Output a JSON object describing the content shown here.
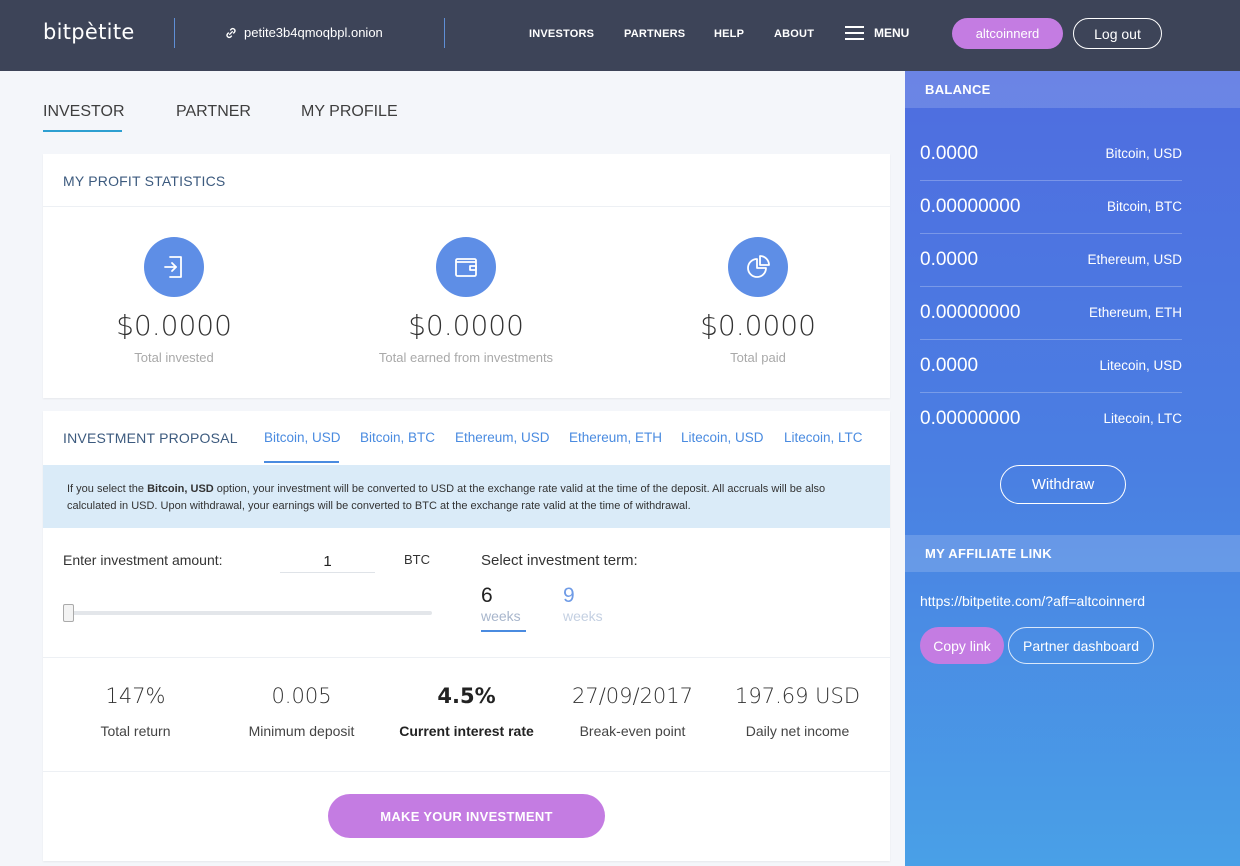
{
  "header": {
    "logo": "bitpètite",
    "onion_address": "petite3b4qmoqbpl.onion",
    "nav": [
      "INVESTORS",
      "PARTNERS",
      "HELP",
      "ABOUT"
    ],
    "menu_label": "MENU",
    "username": "altcoinnerd",
    "logout_label": "Log out"
  },
  "tabs": [
    "INVESTOR",
    "PARTNER",
    "MY PROFILE"
  ],
  "profit_stats": {
    "title": "MY PROFIT STATISTICS",
    "items": [
      {
        "value": "$0.0000",
        "label": "Total invested",
        "icon": "login-icon"
      },
      {
        "value": "$0.0000",
        "label": "Total earned from investments",
        "icon": "wallet-icon"
      },
      {
        "value": "$0.0000",
        "label": "Total paid",
        "icon": "pie-chart-icon"
      }
    ]
  },
  "proposal": {
    "title": "INVESTMENT PROPOSAL",
    "currency_tabs": [
      "Bitcoin, USD",
      "Bitcoin, BTC",
      "Ethereum, USD",
      "Ethereum, ETH",
      "Litecoin, USD",
      "Litecoin, LTC"
    ],
    "info_pre": "If you select the ",
    "info_bold": "Bitcoin, USD",
    "info_post": " option, your investment will be converted to USD at the exchange rate valid at the time of the deposit. All accruals will be also calculated in USD. Upon withdrawal, your earnings will be converted to BTC at the exchange rate valid at the time of withdrawal.",
    "amount_label": "Enter investment amount:",
    "amount_value": "1",
    "amount_unit": "BTC",
    "term_label": "Select investment term:",
    "terms": [
      {
        "num": "6",
        "unit": "weeks"
      },
      {
        "num": "9",
        "unit": "weeks"
      }
    ],
    "metrics": [
      {
        "value": "147%",
        "label": "Total return"
      },
      {
        "value": "0.005",
        "label": "Minimum deposit"
      },
      {
        "value": "4.5%",
        "label": "Current interest rate"
      },
      {
        "value": "27/09/2017",
        "label": "Break-even point"
      },
      {
        "value": "197.69 USD",
        "label": "Daily net income"
      }
    ],
    "invest_button": "MAKE YOUR INVESTMENT"
  },
  "sidebar": {
    "balance_title": "BALANCE",
    "balances": [
      {
        "amount": "0.0000",
        "label": "Bitcoin, USD"
      },
      {
        "amount": "0.00000000",
        "label": "Bitcoin, BTC"
      },
      {
        "amount": "0.0000",
        "label": "Ethereum, USD"
      },
      {
        "amount": "0.00000000",
        "label": "Ethereum, ETH"
      },
      {
        "amount": "0.0000",
        "label": "Litecoin, USD"
      },
      {
        "amount": "0.00000000",
        "label": "Litecoin, LTC"
      }
    ],
    "withdraw_label": "Withdraw",
    "affiliate_title": "MY AFFILIATE LINK",
    "affiliate_url": "https://bitpetite.com/?aff=altcoinnerd",
    "copy_label": "Copy link",
    "partner_dashboard_label": "Partner dashboard"
  },
  "colors": {
    "topbar": "#3d4458",
    "accent_purple": "#c47ce2",
    "accent_blue": "#4a8be0",
    "icon_blue": "#5e8ee6",
    "info_bg": "#daebf8"
  }
}
